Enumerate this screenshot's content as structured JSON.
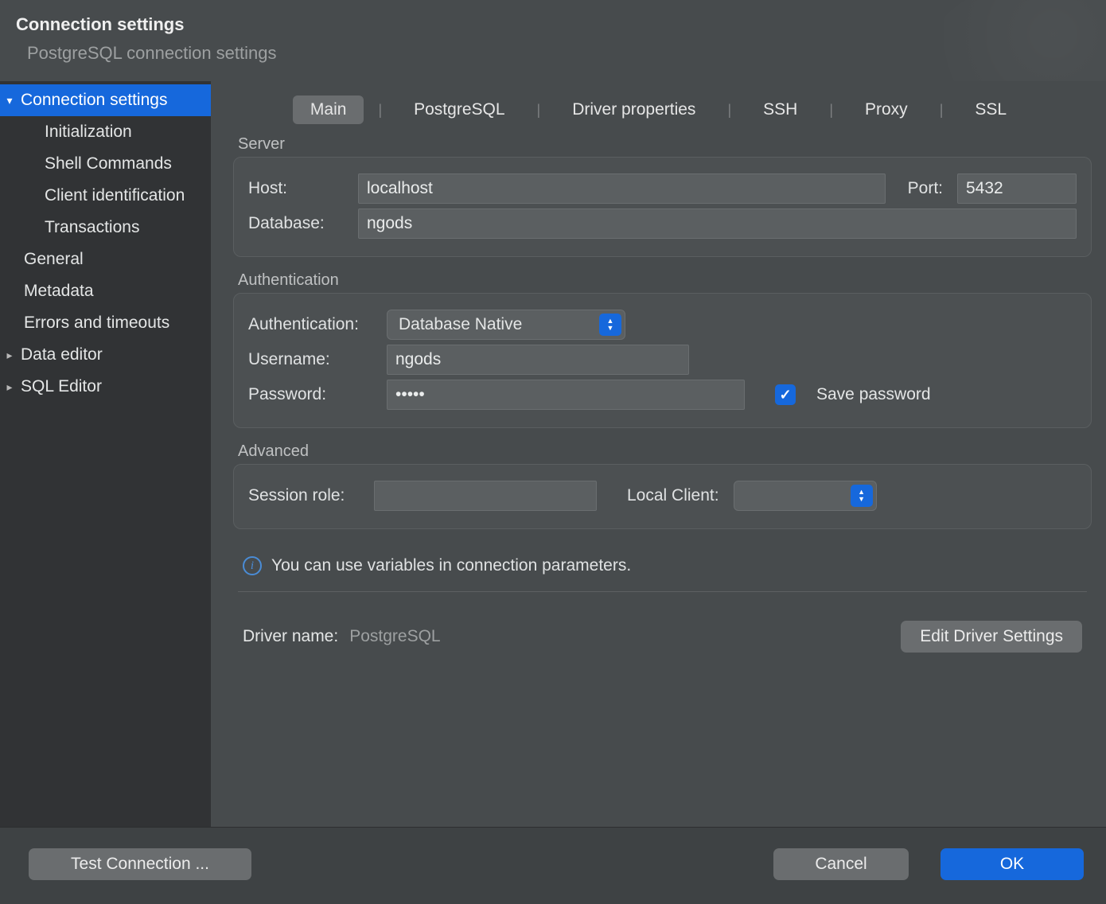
{
  "header": {
    "title": "Connection settings",
    "subtitle": "PostgreSQL connection settings"
  },
  "sidebar": {
    "items": [
      {
        "label": "Connection settings",
        "expanded": true,
        "selected": true,
        "chev": "down"
      },
      {
        "label": "Initialization",
        "child": true
      },
      {
        "label": "Shell Commands",
        "child": true
      },
      {
        "label": "Client identification",
        "child": true
      },
      {
        "label": "Transactions",
        "child": true
      },
      {
        "label": "General"
      },
      {
        "label": "Metadata"
      },
      {
        "label": "Errors and timeouts"
      },
      {
        "label": "Data editor",
        "chev": "right"
      },
      {
        "label": "SQL Editor",
        "chev": "right"
      }
    ]
  },
  "tabs": [
    "Main",
    "PostgreSQL",
    "Driver properties",
    "SSH",
    "Proxy",
    "SSL"
  ],
  "active_tab": "Main",
  "server": {
    "label": "Server",
    "host_label": "Host:",
    "host": "localhost",
    "port_label": "Port:",
    "port": "5432",
    "database_label": "Database:",
    "database": "ngods"
  },
  "auth": {
    "label": "Authentication",
    "auth_label": "Authentication:",
    "auth_mode": "Database Native",
    "username_label": "Username:",
    "username": "ngods",
    "password_label": "Password:",
    "password": "•••••",
    "save_password_label": "Save password",
    "save_password_checked": true
  },
  "advanced": {
    "label": "Advanced",
    "session_role_label": "Session role:",
    "session_role": "",
    "local_client_label": "Local Client:",
    "local_client": ""
  },
  "info": {
    "text": "You can use variables in connection parameters."
  },
  "driver": {
    "label": "Driver name:",
    "name": "PostgreSQL",
    "edit_button": "Edit Driver Settings"
  },
  "footer": {
    "test": "Test Connection ...",
    "cancel": "Cancel",
    "ok": "OK"
  }
}
